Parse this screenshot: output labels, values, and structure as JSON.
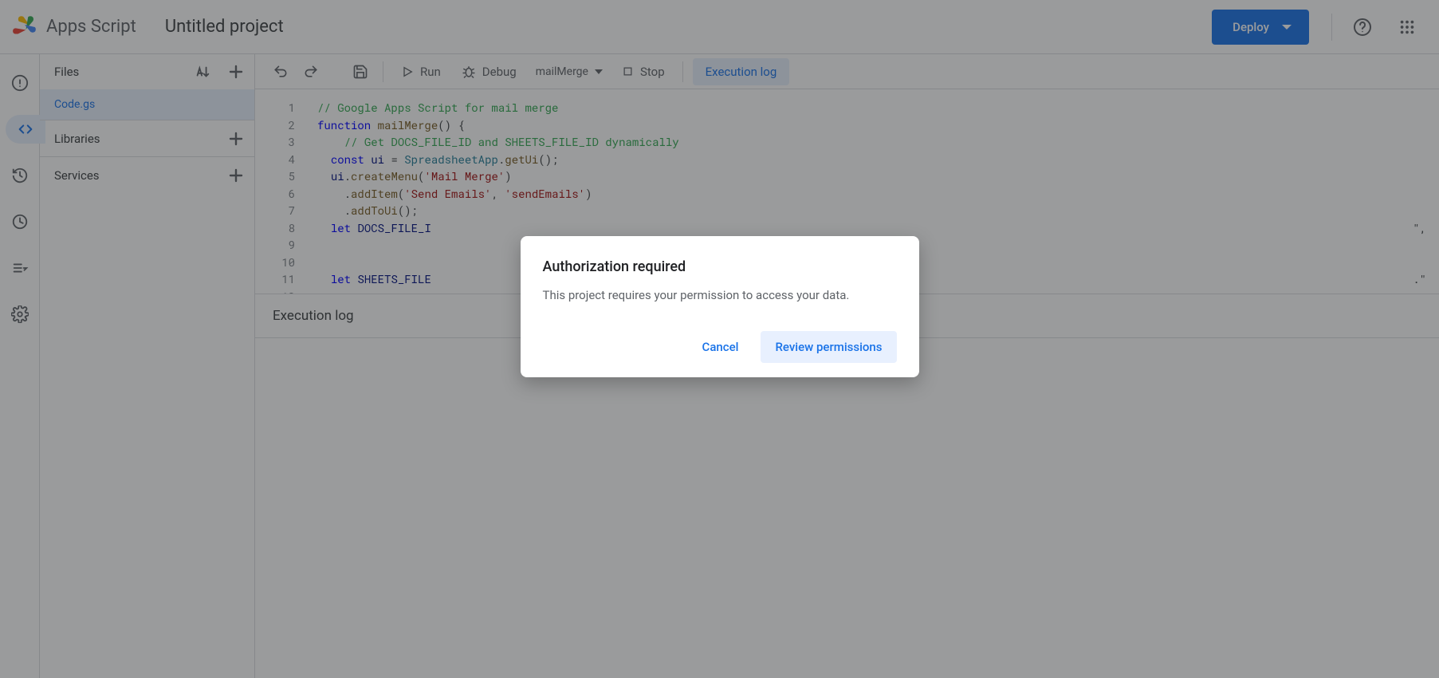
{
  "header": {
    "product": "Apps Script",
    "project_title": "Untitled project",
    "deploy_label": "Deploy"
  },
  "rail": {
    "items": [
      "info",
      "editor",
      "history",
      "triggers",
      "executions",
      "settings"
    ]
  },
  "files": {
    "header_label": "Files",
    "active_file": "Code.gs",
    "libraries_label": "Libraries",
    "services_label": "Services"
  },
  "toolbar": {
    "run_label": "Run",
    "debug_label": "Debug",
    "function_selected": "mailMerge",
    "stop_label": "Stop",
    "execution_log_label": "Execution log"
  },
  "code": {
    "lines": [
      "// Google Apps Script for mail merge",
      "function mailMerge() {",
      "  // Get DOCS_FILE_ID and SHEETS_FILE_ID dynamically",
      "  const ui = SpreadsheetApp.getUi();",
      "  ui.createMenu('Mail Merge')",
      "    .addItem('Send Emails', 'sendEmails')",
      "    .addToUi();",
      "  let DOCS_FILE_I",
      "",
      "",
      "  let SHEETS_FILE"
    ],
    "truncated_right_1": "\",",
    "truncated_right_2": ".\""
  },
  "exec_panel": {
    "title": "Execution log"
  },
  "dialog": {
    "title": "Authorization required",
    "body": "This project requires your permission to access your data.",
    "cancel": "Cancel",
    "review": "Review permissions"
  }
}
